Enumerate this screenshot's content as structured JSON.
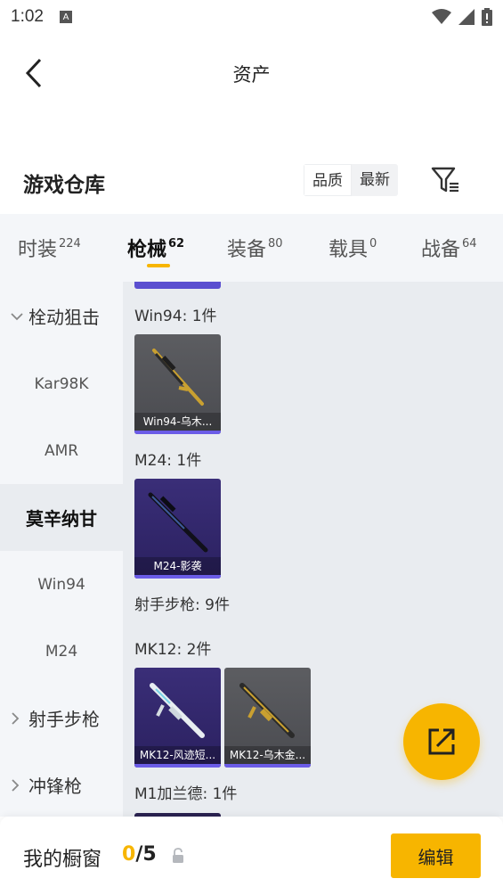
{
  "status_bar": {
    "time": "1:02",
    "notification_icon": "a-icon"
  },
  "header": {
    "title": "资产"
  },
  "warehouse": {
    "title": "游戏仓库",
    "sort_options": [
      "品质",
      "最新"
    ],
    "filter_icon": "filter-icon"
  },
  "tabs": [
    {
      "label": "时装",
      "count": "224",
      "active": false
    },
    {
      "label": "枪械",
      "count": "62",
      "active": true
    },
    {
      "label": "装备",
      "count": "80",
      "active": false
    },
    {
      "label": "载具",
      "count": "0",
      "active": false
    },
    {
      "label": "战备",
      "count": "64",
      "active": false
    }
  ],
  "side_nav": [
    {
      "label": "栓动狙击",
      "type": "group",
      "expanded": true
    },
    {
      "label": "Kar98K",
      "type": "item"
    },
    {
      "label": "AMR",
      "type": "item"
    },
    {
      "label": "莫辛纳甘",
      "type": "item",
      "active": true
    },
    {
      "label": "Win94",
      "type": "item"
    },
    {
      "label": "M24",
      "type": "item"
    },
    {
      "label": "射手步枪",
      "type": "group",
      "expanded": false
    },
    {
      "label": "冲锋枪",
      "type": "group",
      "expanded": false
    }
  ],
  "content": {
    "sections": [
      {
        "label": "Win94: 1件"
      },
      {
        "label": "M24: 1件"
      },
      {
        "label": "射手步枪: 9件"
      },
      {
        "label": "MK12: 2件"
      },
      {
        "label": "M1加兰德: 1件"
      }
    ],
    "items": [
      {
        "name": "Win94-乌木...",
        "style": "gray"
      },
      {
        "name": "M24-影袭",
        "style": "purple"
      },
      {
        "name": "MK12-风迹短...",
        "style": "purple"
      },
      {
        "name": "MK12-乌木金...",
        "style": "gray"
      }
    ]
  },
  "fab": {
    "icon": "share-edit-icon"
  },
  "bottom_bar": {
    "label": "我的橱窗",
    "current": "0",
    "separator": "/",
    "total": "5",
    "edit_label": "编辑"
  },
  "colors": {
    "accent": "#f7b500",
    "rarity_purple": "#6b5ce7"
  }
}
